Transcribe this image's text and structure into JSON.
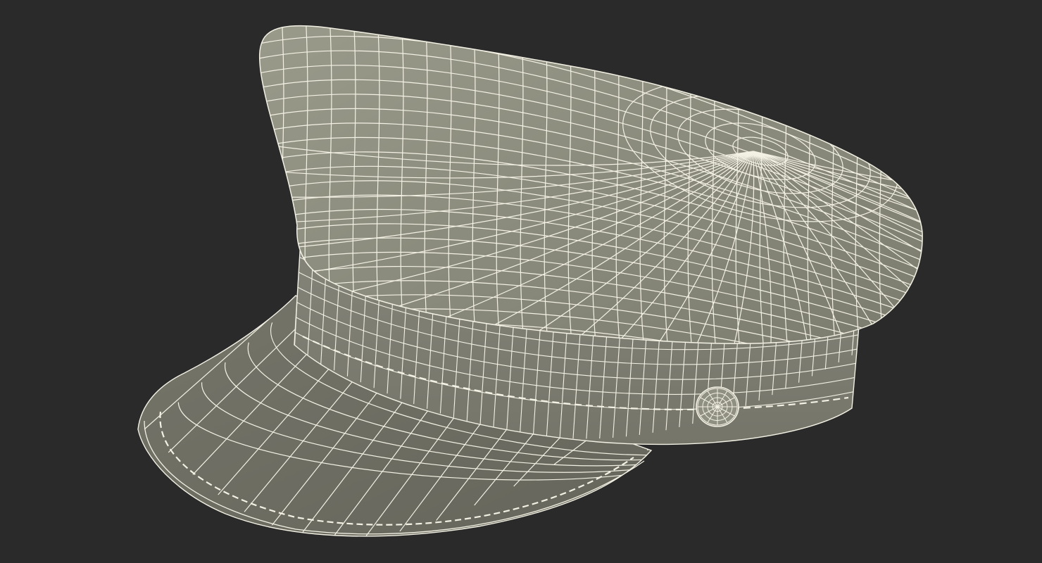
{
  "scene": {
    "subject_icon": "wireframe-cap-icon",
    "colors": {
      "background": "#2a2a2a",
      "surface": "#8a8a7c",
      "surface_dark": "#6f6f63",
      "surface_light": "#a2a293",
      "wire": "#f3f1e4"
    }
  }
}
